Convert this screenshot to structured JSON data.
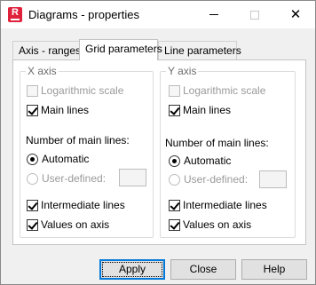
{
  "window": {
    "title": "Diagrams - properties",
    "app_icon_letter": "R"
  },
  "tabs": [
    {
      "label": "Axis - ranges",
      "active": false
    },
    {
      "label": "Grid parameters",
      "active": true
    },
    {
      "label": "Line parameters",
      "active": false
    }
  ],
  "x_axis": {
    "legend": "X axis",
    "logarithmic_label": "Logarithmic scale",
    "logarithmic_checked": false,
    "logarithmic_enabled": false,
    "main_lines_label": "Main lines",
    "main_lines_checked": true,
    "number_label": "Number of main lines:",
    "automatic_label": "Automatic",
    "user_defined_label": "User-defined:",
    "selected_mode": "Automatic",
    "user_defined_value": "",
    "intermediate_label": "Intermediate lines",
    "intermediate_checked": true,
    "values_label": "Values on axis",
    "values_checked": true
  },
  "y_axis": {
    "legend": "Y axis",
    "logarithmic_label": "Logarithmic scale",
    "logarithmic_checked": false,
    "logarithmic_enabled": false,
    "main_lines_label": "Main lines",
    "main_lines_checked": true,
    "number_label": "Number of main lines:",
    "automatic_label": "Automatic",
    "user_defined_label": "User-defined:",
    "selected_mode": "Automatic",
    "user_defined_value": "",
    "intermediate_label": "Intermediate lines",
    "intermediate_checked": true,
    "values_label": "Values on axis",
    "values_checked": true
  },
  "buttons": {
    "apply": "Apply",
    "close": "Close",
    "help": "Help"
  },
  "colors": {
    "accent": "#0078d7",
    "app_icon": "#e0213c"
  }
}
